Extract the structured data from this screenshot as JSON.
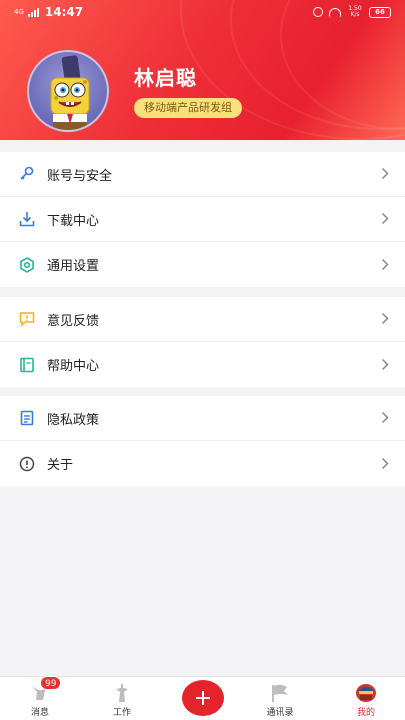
{
  "status_bar": {
    "network": "4G",
    "time": "14:47",
    "speed": "1.50 K/s",
    "battery": "66"
  },
  "profile": {
    "name": "林启聪",
    "department": "移动端产品研发组"
  },
  "menu_groups": [
    {
      "items": [
        {
          "label": "账号与安全",
          "icon": "key-icon"
        },
        {
          "label": "下载中心",
          "icon": "download-icon"
        },
        {
          "label": "通用设置",
          "icon": "settings-hexagon-icon"
        }
      ]
    },
    {
      "items": [
        {
          "label": "意见反馈",
          "icon": "feedback-icon"
        },
        {
          "label": "帮助中心",
          "icon": "help-book-icon"
        }
      ]
    },
    {
      "items": [
        {
          "label": "隐私政策",
          "icon": "document-icon"
        },
        {
          "label": "关于",
          "icon": "info-icon"
        }
      ]
    }
  ],
  "tabbar": {
    "messages": {
      "label": "消息",
      "badge": "99"
    },
    "work": {
      "label": "工作"
    },
    "contacts": {
      "label": "通讯录"
    },
    "me": {
      "label": "我的"
    }
  },
  "colors": {
    "accent": "#e3242b",
    "badge_bg": "#f8e07a",
    "icon_blue": "#3a7bd5",
    "icon_teal": "#2bb39a",
    "icon_yellow": "#f0b429"
  }
}
